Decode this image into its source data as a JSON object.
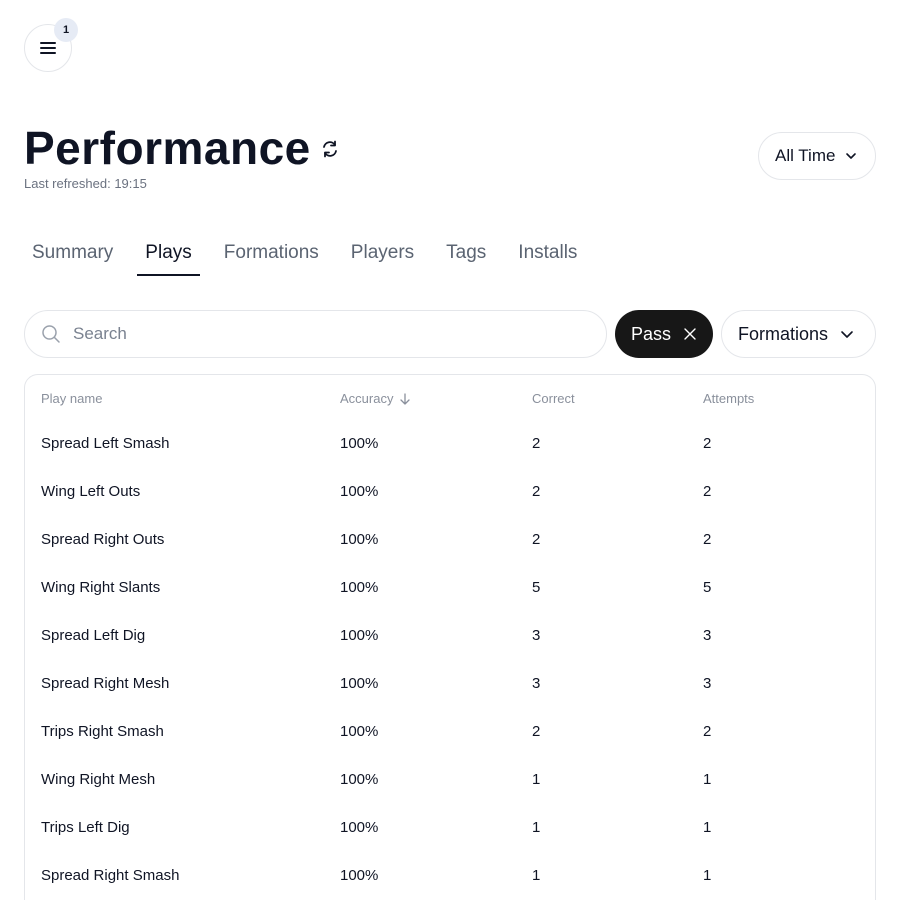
{
  "header": {
    "notification_count": "1",
    "title": "Performance",
    "last_refreshed": "Last refreshed: 19:15",
    "time_filter": "All Time"
  },
  "tabs": [
    {
      "label": "Summary",
      "active": false
    },
    {
      "label": "Plays",
      "active": true
    },
    {
      "label": "Formations",
      "active": false
    },
    {
      "label": "Players",
      "active": false
    },
    {
      "label": "Tags",
      "active": false
    },
    {
      "label": "Installs",
      "active": false
    }
  ],
  "filters": {
    "search_placeholder": "Search",
    "search_value": "",
    "active_chip": "Pass",
    "formations_label": "Formations"
  },
  "table": {
    "headers": {
      "play_name": "Play name",
      "accuracy": "Accuracy",
      "correct": "Correct",
      "attempts": "Attempts"
    },
    "sort": {
      "column": "accuracy",
      "direction": "desc"
    },
    "rows": [
      {
        "name": "Spread Left Smash",
        "accuracy": "100%",
        "correct": "2",
        "attempts": "2"
      },
      {
        "name": "Wing Left Outs",
        "accuracy": "100%",
        "correct": "2",
        "attempts": "2"
      },
      {
        "name": "Spread Right Outs",
        "accuracy": "100%",
        "correct": "2",
        "attempts": "2"
      },
      {
        "name": "Wing Right Slants",
        "accuracy": "100%",
        "correct": "5",
        "attempts": "5"
      },
      {
        "name": "Spread Left Dig",
        "accuracy": "100%",
        "correct": "3",
        "attempts": "3"
      },
      {
        "name": "Spread Right Mesh",
        "accuracy": "100%",
        "correct": "3",
        "attempts": "3"
      },
      {
        "name": "Trips Right Smash",
        "accuracy": "100%",
        "correct": "2",
        "attempts": "2"
      },
      {
        "name": "Wing Right Mesh",
        "accuracy": "100%",
        "correct": "1",
        "attempts": "1"
      },
      {
        "name": "Trips Left Dig",
        "accuracy": "100%",
        "correct": "1",
        "attempts": "1"
      },
      {
        "name": "Spread Right Smash",
        "accuracy": "100%",
        "correct": "1",
        "attempts": "1"
      }
    ]
  },
  "colors": {
    "text_primary": "#0f1424",
    "chip_background": "#171717",
    "border": "#e4e6ea",
    "badge_background": "#e6ebf5"
  },
  "icons": {
    "menu": "hamburger-menu-icon",
    "refresh": "refresh-icon",
    "chevron": "chevron-down-icon",
    "search": "search-icon",
    "close": "close-icon",
    "sort": "arrow-down-icon"
  }
}
